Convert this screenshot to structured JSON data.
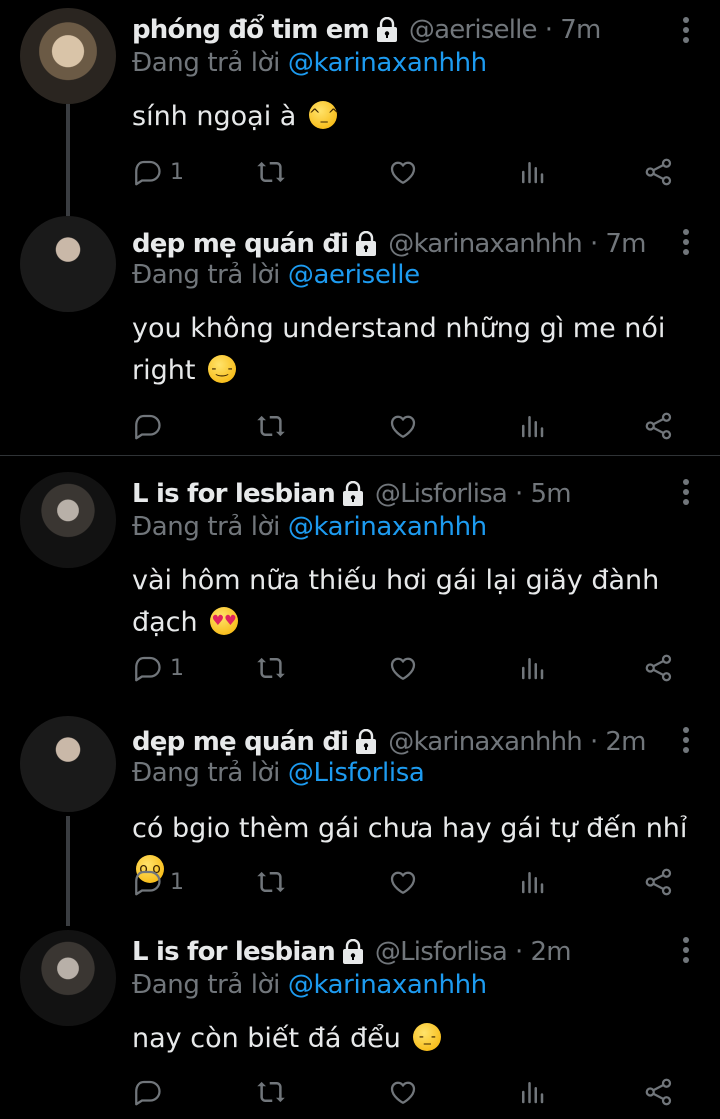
{
  "colors": {
    "background": "#000000",
    "text": "#e7e9ea",
    "muted": "#71767b",
    "link": "#1d9bf0"
  },
  "reply_prefix": "Đang trả lời",
  "tweets": [
    {
      "name": "phóng đổ tim em",
      "handle": "@aeriselle",
      "dot": "·",
      "time": "7m",
      "reply_to": "@karinaxanhhh",
      "text": "sính ngoại à",
      "emoji": "grinning-sweat-emoji",
      "reply_count": "1",
      "icons": [
        "lock-icon",
        "more-icon",
        "reply-icon",
        "retweet-icon",
        "like-icon",
        "stats-icon",
        "share-icon"
      ]
    },
    {
      "name": "dẹp mẹ quán đi",
      "handle": "@karinaxanhhh",
      "dot": "·",
      "time": "7m",
      "reply_to": "@aeriselle",
      "text": "you không understand những gì me nói right",
      "emoji": "smirk-emoji",
      "reply_count": ""
    },
    {
      "name": "L is for lesbian",
      "handle": "@Lisforlisa",
      "dot": "·",
      "time": "5m",
      "reply_to": "@karinaxanhhh",
      "text": "vài hôm nữa thiếu hơi gái lại giãy đành đạch",
      "emoji": "heart-eyes-emoji",
      "reply_count": "1"
    },
    {
      "name": "dẹp mẹ quán đi",
      "handle": "@karinaxanhhh",
      "dot": "·",
      "time": "2m",
      "reply_to": "@Lisforlisa",
      "text": "có bgio thèm gái chưa hay gái tự đến nhỉ",
      "emoji": "eye-roll-emoji",
      "reply_count": "1"
    },
    {
      "name": "L is for lesbian",
      "handle": "@Lisforlisa",
      "dot": "·",
      "time": "2m",
      "reply_to": "@karinaxanhhh",
      "text": "nay còn biết đá đểu",
      "emoji": "downcast-sweat-emoji",
      "reply_count": ""
    }
  ]
}
